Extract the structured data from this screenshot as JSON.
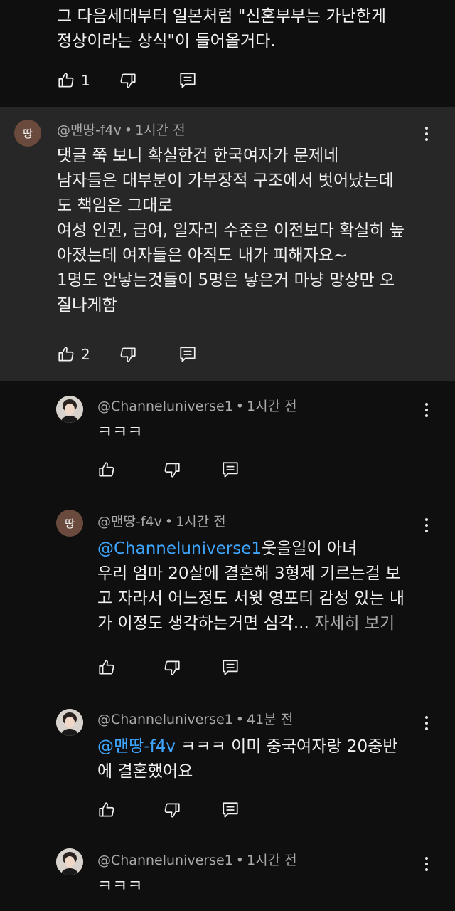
{
  "top": {
    "text": "그 다음세대부터 일본처럼 \"신혼부부는 가난한게\n정상이라는 상식\"이 들어올거다.",
    "likes": "1"
  },
  "main": {
    "avatar": "땅",
    "author": "@맨땅-f4v",
    "time": "1시간 전",
    "text": "댓글 쭉 보니 확실한건 한국여자가 문제네\n남자들은 대부분이 가부장적 구조에서 벗어났는데\n도 책임은 그대로\n여성 인권, 급여, 일자리 수준은 이전보다 확실히 높\n아졌는데 여자들은 아직도 내가 피해자요~\n1명도 안낳는것들이 5명은 낳은거 마냥 망상만 오\n질나게함",
    "likes": "2"
  },
  "replies": [
    {
      "author": "@Channeluniverse1",
      "time": "1시간 전",
      "text": "ㅋㅋㅋ"
    },
    {
      "avatar": "땅",
      "author": "@맨땅-f4v",
      "time": "1시간 전",
      "mention": "@Channeluniverse1",
      "text": "웃을일이 아녀\n우리 엄마 20살에 결혼해 3형제 기르는걸 보\n고 자라서 어느정도 서윗 영포티 감성 있는 내\n가 이정도 생각하는거면 심각...",
      "more": "자세히 보기"
    },
    {
      "author": "@Channeluniverse1",
      "time": "41분 전",
      "mention": "@맨땅-f4v",
      "text": " ㅋㅋㅋ 이미 중국여자랑 20중반\n에 결혼했어요"
    },
    {
      "author": "@Channeluniverse1",
      "time": "1시간 전",
      "text": "ㅋㅋㅋ"
    }
  ],
  "meta_sep": "•",
  "colors": {
    "background": "#0f0f0f",
    "highlight": "#272727",
    "mention": "#3ea6ff",
    "meta": "#aaaaaa"
  },
  "icons": {
    "like": "thumbs-up-icon",
    "dislike": "thumbs-down-icon",
    "reply": "reply-icon",
    "more": "kebab-menu-icon"
  }
}
